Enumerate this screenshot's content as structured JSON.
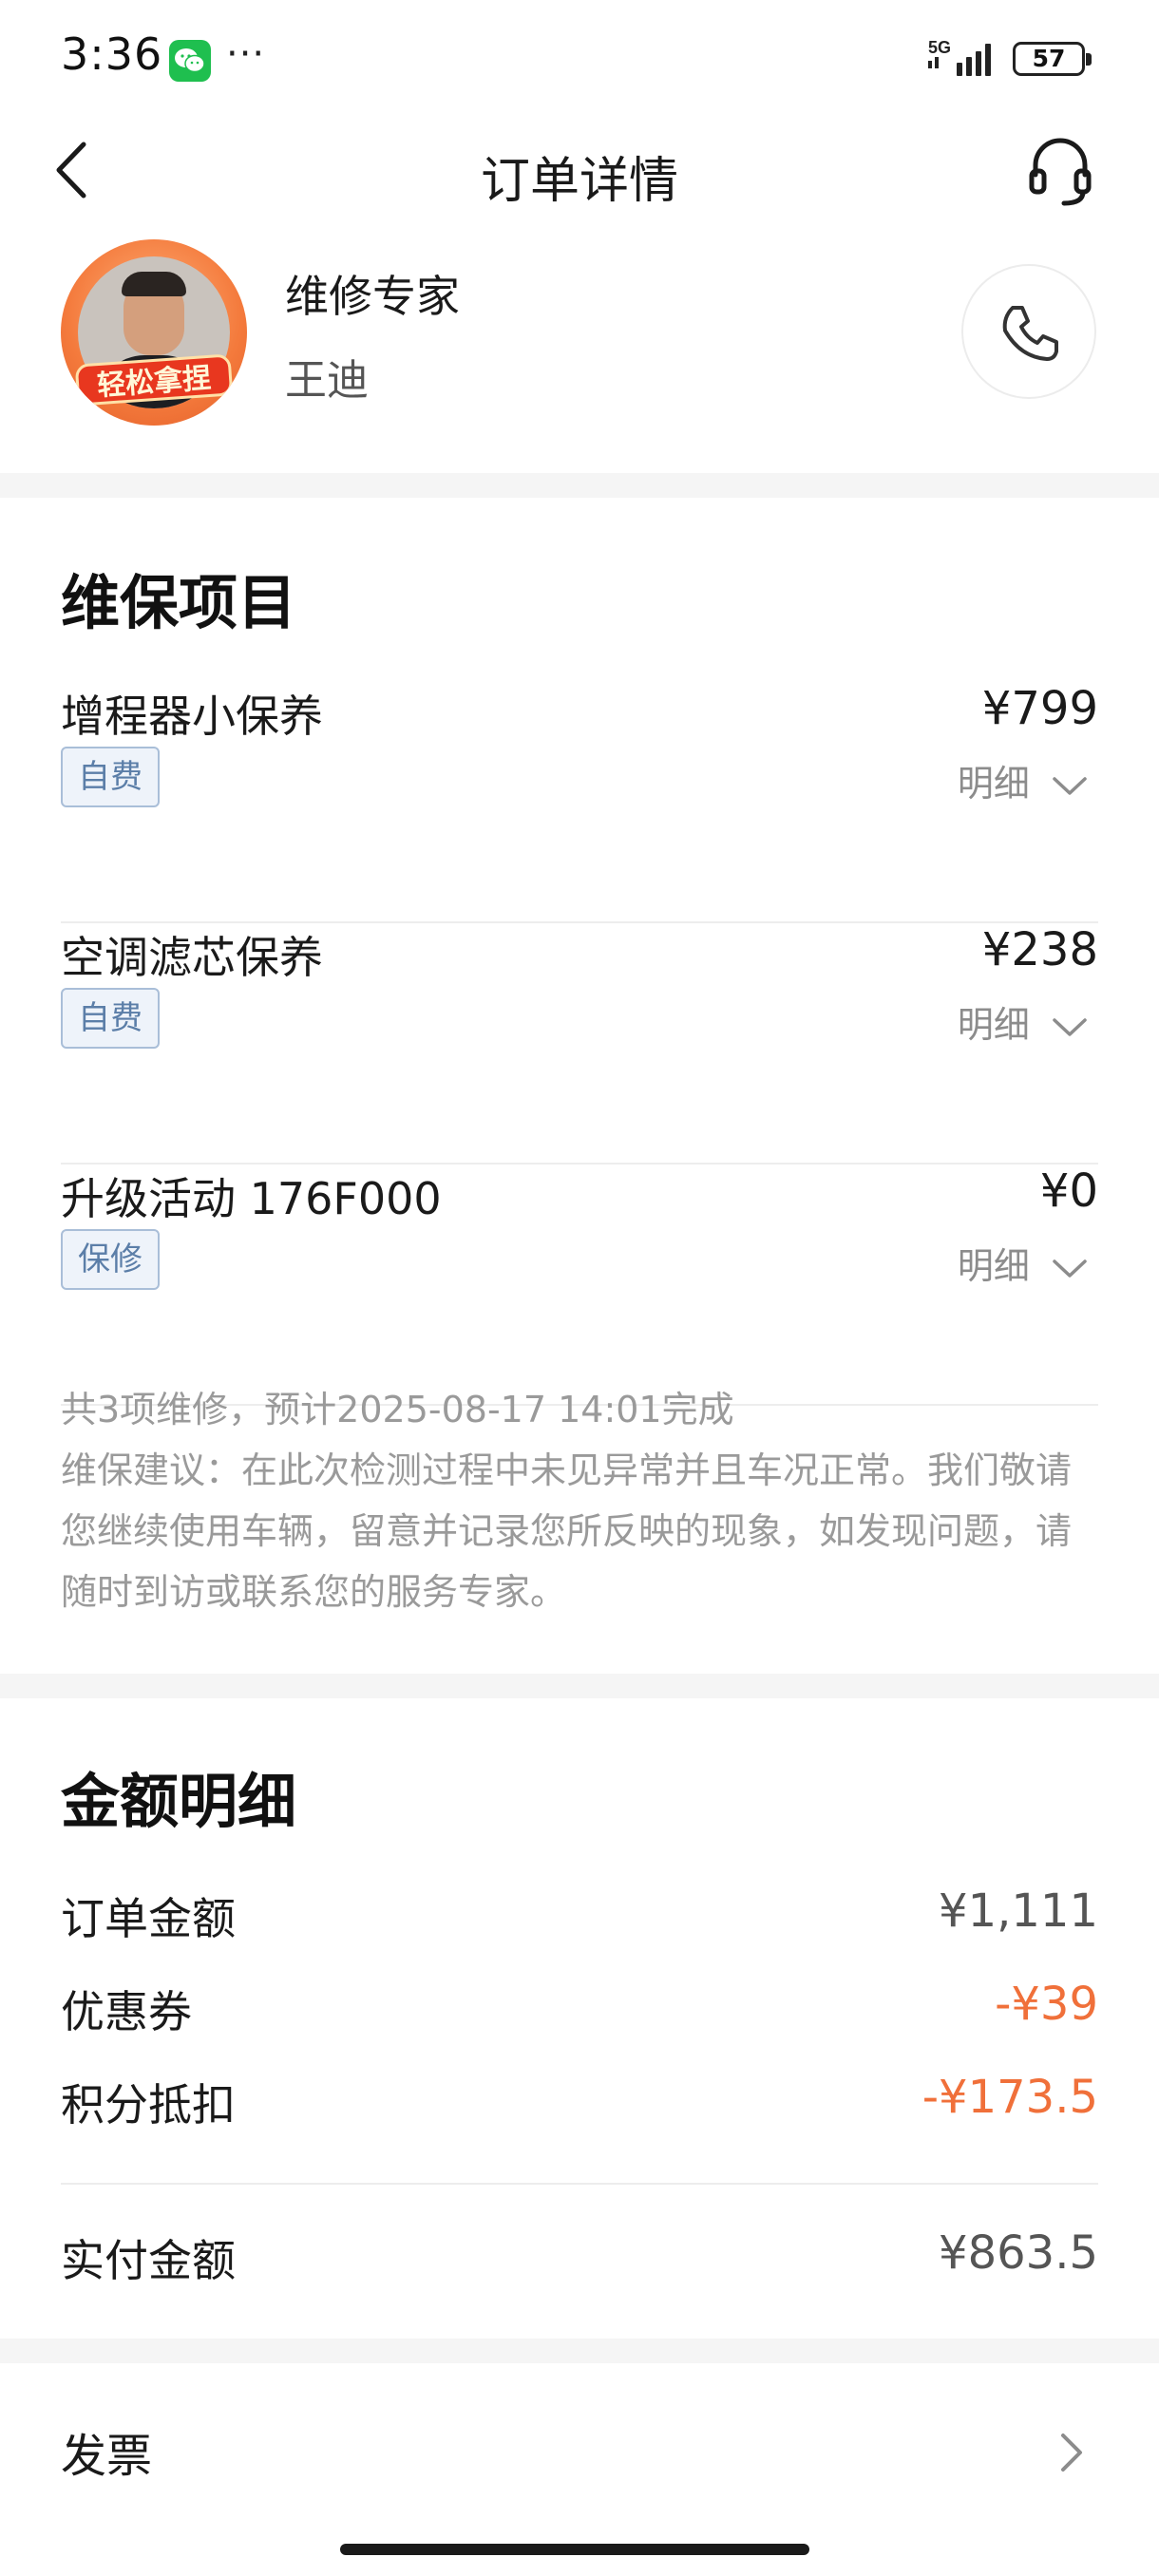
{
  "status_bar": {
    "time": "3:36",
    "dots": "···",
    "network": "5G",
    "battery": "57"
  },
  "nav": {
    "title": "订单详情"
  },
  "expert": {
    "role": "维修专家",
    "name": "王迪",
    "avatar_badge": "轻松拿捏"
  },
  "maintenance": {
    "title": "维保项目",
    "items": [
      {
        "name": "增程器小保养",
        "price": "¥799",
        "tag": "自费",
        "detail_label": "明细"
      },
      {
        "name": "空调滤芯保养",
        "price": "¥238",
        "tag": "自费",
        "detail_label": "明细"
      },
      {
        "name": "升级活动 176F000",
        "price": "¥0",
        "tag": "保修",
        "detail_label": "明细"
      }
    ],
    "summary": "共3项维修，预计2025-08-17 14:01完成",
    "advice": "维保建议：在此次检测过程中未见异常并且车况正常。我们敬请您继续使用车辆，留意并记录您所反映的现象，如发现问题，请随时到访或联系您的服务专家。"
  },
  "amount": {
    "title": "金额明细",
    "rows": [
      {
        "label": "订单金额",
        "value": "¥1,111"
      },
      {
        "label": "优惠券",
        "value": "-¥39"
      },
      {
        "label": "积分抵扣",
        "value": "-¥173.5"
      }
    ],
    "paid_label": "实付金额",
    "paid_value": "¥863.5"
  },
  "invoice": {
    "label": "发票"
  },
  "colors": {
    "discount": "#f0703a",
    "tag_text": "#5b7ea8",
    "tag_border": "#a9bed8",
    "muted": "#9a9a9a"
  }
}
